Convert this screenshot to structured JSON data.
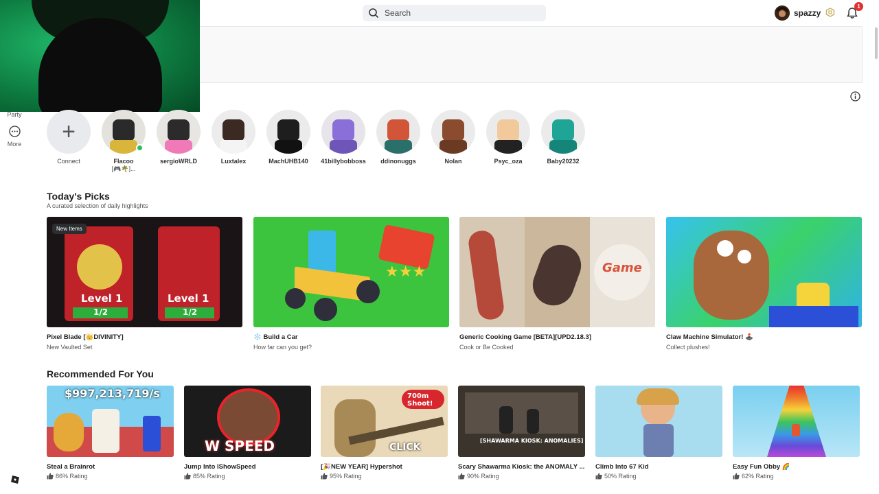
{
  "header": {
    "search_placeholder": "Search",
    "username": "spazzy",
    "notification_count": "1"
  },
  "rail": {
    "party_label": "Party",
    "more_label": "More"
  },
  "friends": {
    "connect_label": "Connect",
    "items": [
      {
        "name": "Flacoo",
        "status": "[🎮🌴]...",
        "online": true
      },
      {
        "name": "sergioWRLD",
        "status": ""
      },
      {
        "name": "Luxtalex",
        "status": ""
      },
      {
        "name": "MachUHB140",
        "status": ""
      },
      {
        "name": "41billybobboss",
        "status": ""
      },
      {
        "name": "ddinonuggs",
        "status": ""
      },
      {
        "name": "Nolan",
        "status": ""
      },
      {
        "name": "Psyc_oza",
        "status": ""
      },
      {
        "name": "Baby20232",
        "status": ""
      }
    ]
  },
  "todays_picks": {
    "title": "Today's Picks",
    "subtitle": "A curated selection of daily highlights",
    "items": [
      {
        "title": "Pixel Blade [👑DIVINITY]",
        "sub": "New Vaulted Set",
        "tag": "New Items",
        "thumb_text_1": "Level 1",
        "thumb_text_2": "1/2"
      },
      {
        "title": "❄️ Build a Car",
        "sub": "How far can you get?"
      },
      {
        "title": "Generic Cooking Game [BETA][UPD2.18.3]",
        "sub": "Cook or Be Cooked",
        "thumb_text_1": "Game"
      },
      {
        "title": "Claw Machine Simulator! 🕹️",
        "sub": "Collect plushes!"
      }
    ]
  },
  "recommended": {
    "title": "Recommended For You",
    "items": [
      {
        "title": "Steal a Brainrot",
        "rating": "86% Rating",
        "thumb_text": "$997,213,719/s"
      },
      {
        "title": "Jump Into IShowSpeed",
        "rating": "85% Rating",
        "thumb_text": "W SPEED"
      },
      {
        "title": "[🎉NEW YEAR] Hypershot",
        "rating": "95% Rating",
        "thumb_text": "700m Shoot!",
        "thumb_text_2": "CLICK"
      },
      {
        "title": "Scary Shawarma Kiosk: the ANOMALY ...",
        "rating": "90% Rating",
        "thumb_text": "[SHAWARMA KIOSK: ANOMALIES]"
      },
      {
        "title": "Climb Into 67 Kid",
        "rating": "50% Rating"
      },
      {
        "title": "Easy Fun Obby 🌈",
        "rating": "62% Rating"
      }
    ]
  },
  "colors": {
    "online": "#2dbe5f",
    "badge": "#e3302e",
    "search_bg": "#eff1f4"
  }
}
